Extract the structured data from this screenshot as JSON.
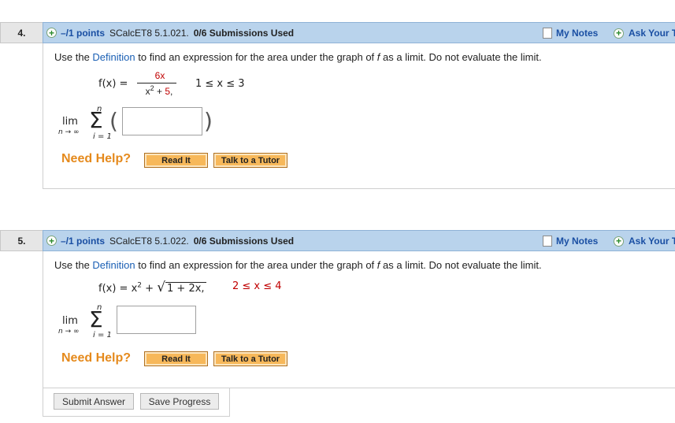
{
  "questions": [
    {
      "number": "4.",
      "points": "–/1 points",
      "course": "SCalcET8 5.1.021.",
      "submissions": "0/6 Submissions Used",
      "my_notes": "My Notes",
      "ask_teacher": "Ask Your Te",
      "prompt_pre": "Use the ",
      "prompt_link": "Definition",
      "prompt_mid": " to find an expression for the area under the graph of ",
      "prompt_var": "f",
      "prompt_post": " as a limit. Do not evaluate the limit.",
      "fx_label": "f(x) =",
      "numerator": "6x",
      "denominator_base": "x",
      "denominator_exp": "2",
      "denominator_rest": "+",
      "denominator_const": "5",
      "interval": "1 ≤ x ≤ 3",
      "sum_upper": "n",
      "sum_lower": "i = 1",
      "lim": "lim",
      "lim_sub": "n → ∞",
      "need_help": "Need Help?",
      "read_it": "Read It",
      "talk_tutor": "Talk to a Tutor"
    },
    {
      "number": "5.",
      "points": "–/1 points",
      "course": "SCalcET8 5.1.022.",
      "submissions": "0/6 Submissions Used",
      "my_notes": "My Notes",
      "ask_teacher": "Ask Your Te",
      "prompt_pre": "Use the ",
      "prompt_link": "Definition",
      "prompt_mid": " to find an expression for the area under the graph of ",
      "prompt_var": "f",
      "prompt_post": " as a limit. Do not evaluate the limit.",
      "fx_expr": "f(x) = x",
      "fx_exp": "2",
      "fx_plus": "+",
      "sqrt_content": "1 + 2x,",
      "interval": "2 ≤ x ≤ 4",
      "sum_upper": "n",
      "sum_lower": "i = 1",
      "lim": "lim",
      "lim_sub": "n → ∞",
      "need_help": "Need Help?",
      "read_it": "Read It",
      "talk_tutor": "Talk to a Tutor"
    }
  ],
  "footer": {
    "submit": "Submit Answer",
    "save": "Save Progress"
  },
  "colors": {
    "header_bar": "#b9d3ec",
    "points_link": "#1a4fa3",
    "need_help": "#e58a1d",
    "help_button": "#f7b85a",
    "interval_red": "#c00000"
  }
}
